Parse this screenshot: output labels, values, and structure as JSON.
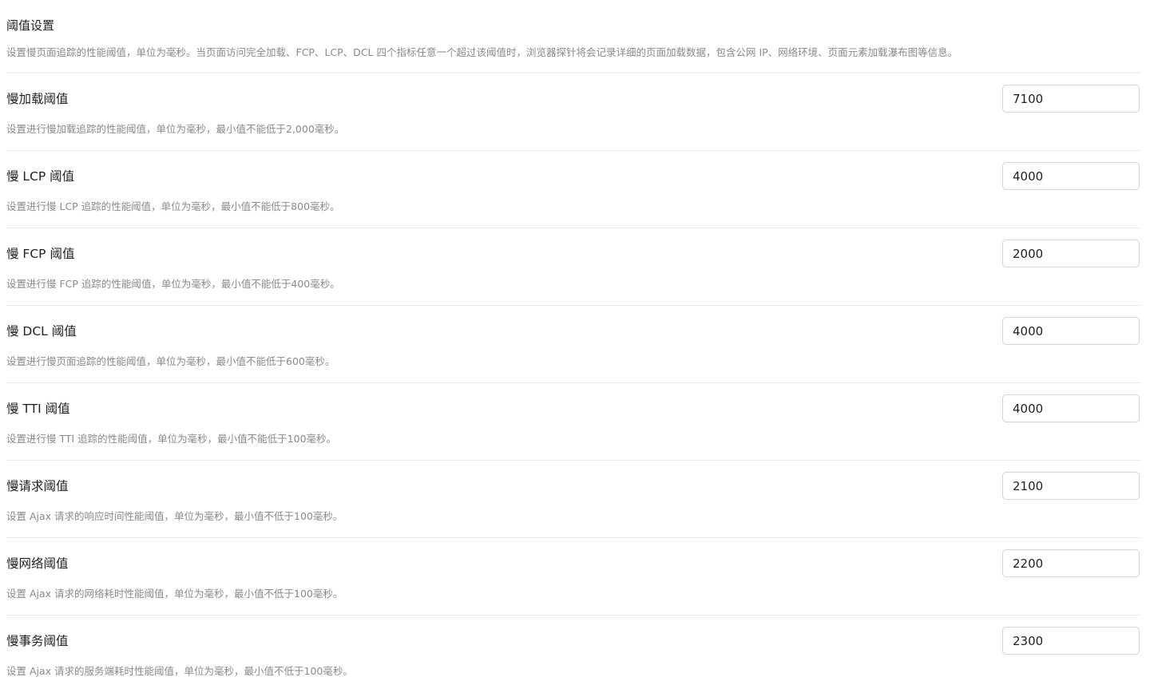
{
  "section": {
    "title": "阈值设置",
    "description": "设置慢页面追踪的性能阈值，单位为毫秒。当页面访问完全加载、FCP、LCP、DCL 四个指标任意一个超过该阈值时，浏览器探针将会记录详细的页面加载数据，包含公网 IP、网络环境、页面元素加载瀑布图等信息。"
  },
  "rows": [
    {
      "label": "慢加载阈值",
      "description": "设置进行慢加载追踪的性能阈值，单位为毫秒，最小值不能低于2,000毫秒。",
      "value": "7100"
    },
    {
      "label": "慢 LCP 阈值",
      "description": "设置进行慢 LCP 追踪的性能阈值，单位为毫秒，最小值不能低于800毫秒。",
      "value": "4000"
    },
    {
      "label": "慢 FCP 阈值",
      "description": "设置进行慢 FCP 追踪的性能阈值，单位为毫秒，最小值不能低于400毫秒。",
      "value": "2000"
    },
    {
      "label": "慢 DCL 阈值",
      "description": "设置进行慢页面追踪的性能阈值，单位为毫秒，最小值不能低于600毫秒。",
      "value": "4000"
    },
    {
      "label": "慢 TTI 阈值",
      "description": "设置进行慢 TTI 追踪的性能阈值，单位为毫秒，最小值不能低于100毫秒。",
      "value": "4000"
    },
    {
      "label": "慢请求阈值",
      "description": "设置 Ajax 请求的响应时间性能阈值，单位为毫秒，最小值不低于100毫秒。",
      "value": "2100"
    },
    {
      "label": "慢网络阈值",
      "description": "设置 Ajax 请求的网络耗时性能阈值，单位为毫秒，最小值不低于100毫秒。",
      "value": "2200"
    },
    {
      "label": "慢事务阈值",
      "description": "设置 Ajax 请求的服务端耗时性能阈值，单位为毫秒，最小值不低于100毫秒。",
      "value": "2300"
    }
  ]
}
